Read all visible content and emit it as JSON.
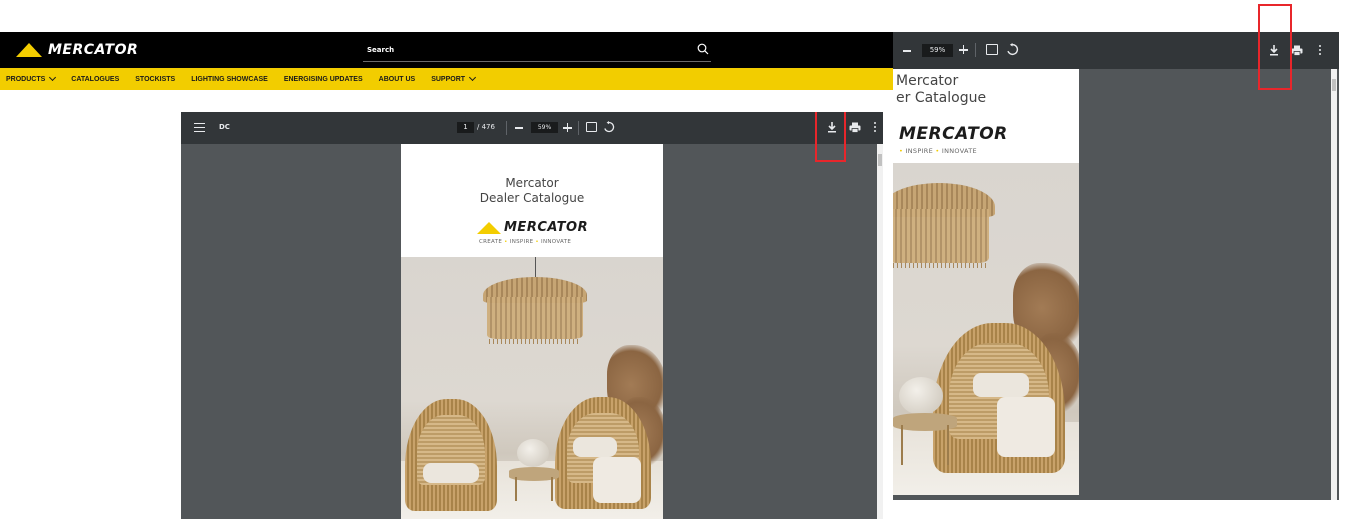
{
  "site": {
    "logo_text": "MERCATOR",
    "search_placeholder": "Search",
    "nav": [
      {
        "label": "PRODUCTS",
        "has_dropdown": true
      },
      {
        "label": "CATALOGUES",
        "has_dropdown": false
      },
      {
        "label": "STOCKISTS",
        "has_dropdown": false
      },
      {
        "label": "LIGHTING SHOWCASE",
        "has_dropdown": false
      },
      {
        "label": "ENERGISING UPDATES",
        "has_dropdown": false
      },
      {
        "label": "ABOUT US",
        "has_dropdown": false
      },
      {
        "label": "SUPPORT",
        "has_dropdown": true
      }
    ],
    "colors": {
      "header_bg": "#000000",
      "nav_bg": "#f2cd00",
      "accent": "#f3cd00"
    }
  },
  "viewer_main": {
    "doc_title": "DC",
    "page_current": "1",
    "page_total": "/ 476",
    "zoom": "59%",
    "icons": [
      "menu-icon",
      "zoom-out-icon",
      "zoom-in-icon",
      "fit-page-icon",
      "rotate-icon",
      "download-icon",
      "print-icon",
      "more-options-icon"
    ]
  },
  "viewer_right": {
    "zoom": "59%"
  },
  "catalogue": {
    "title_line1": "Mercator",
    "title_line2": "Dealer Catalogue",
    "title_line2_cropped": "er Catalogue",
    "logo_text": "MERCATOR",
    "tagline": [
      "CREATE",
      "INSPIRE",
      "INNOVATE"
    ]
  },
  "highlight_color": "#e8262b"
}
